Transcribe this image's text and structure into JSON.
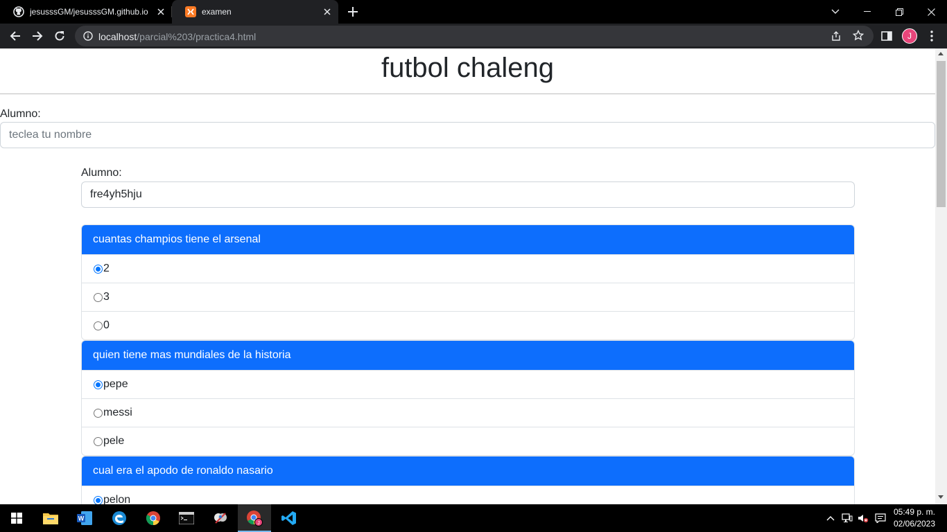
{
  "browser": {
    "tabs": [
      {
        "title": "jesusssGM/jesusssGM.github.io",
        "icon": "github-icon"
      },
      {
        "title": "examen",
        "icon": "xampp-icon"
      }
    ],
    "url_host": "localhost",
    "url_path": "/parcial%203/practica4.html",
    "profile_initial": "J"
  },
  "page": {
    "title": "futbol chaleng",
    "alumno_label": "Alumno:",
    "alumno_placeholder": "teclea tu nombre",
    "form": {
      "alumno_label": "Alumno:",
      "alumno_value": "fre4yh5hju"
    },
    "questions": [
      {
        "question": "cuantas champios tiene el arsenal",
        "options": [
          {
            "label": "2",
            "checked": true
          },
          {
            "label": "3",
            "checked": false
          },
          {
            "label": "0",
            "checked": false
          }
        ]
      },
      {
        "question": "quien tiene mas mundiales de la historia",
        "options": [
          {
            "label": "pepe",
            "checked": true
          },
          {
            "label": "messi",
            "checked": false
          },
          {
            "label": "pele",
            "checked": false
          }
        ]
      },
      {
        "question": "cual era el apodo de ronaldo nasario",
        "options": [
          {
            "label": "pelon",
            "checked": true
          }
        ]
      }
    ]
  },
  "taskbar": {
    "time": "05:49 p. m.",
    "date": "02/06/2023"
  },
  "colors": {
    "primary": "#0d6efd",
    "radio_checked": "#0075ff",
    "chrome_bg": "#202124"
  }
}
